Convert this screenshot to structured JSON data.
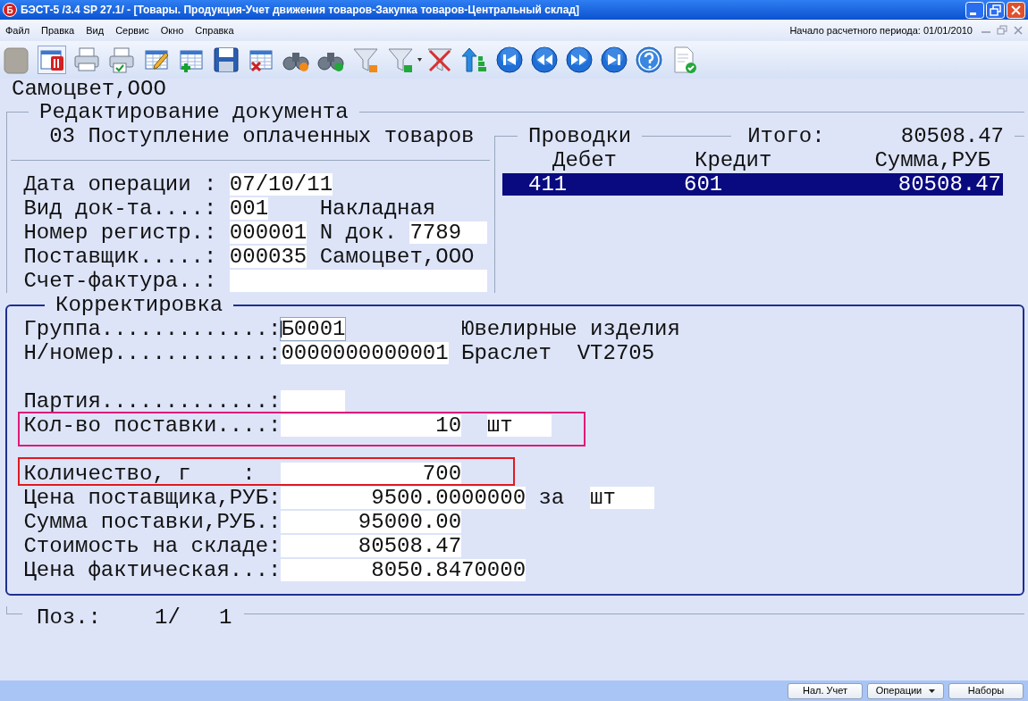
{
  "window": {
    "icon_letter": "Б",
    "title": "БЭСТ-5 /3.4 SP 27.1/ - [Товары. Продукция-Учет движения товаров-Закупка товаров-Центральный склад]"
  },
  "menu": [
    "Файл",
    "Правка",
    "Вид",
    "Сервис",
    "Окно",
    "Справка"
  ],
  "period": "Начало расчетного периода: 01/01/2010",
  "company": "Самоцвет,ООО",
  "document": {
    "title": "Редактирование документа",
    "operation": "03 Поступление оплаченных товаров",
    "rows": [
      {
        "label": "Дата операции :",
        "cells": [
          {
            "kind": "field",
            "value": "07/10/11",
            "focused": false
          }
        ]
      },
      {
        "label": "Вид док-та....:",
        "cells": [
          {
            "kind": "field",
            "value": "001",
            "focused": false
          },
          {
            "kind": "text",
            "value": "Накладная"
          }
        ]
      },
      {
        "label": "Номер регистр.:",
        "cells": [
          {
            "kind": "field",
            "value": "000001",
            "focused": false
          },
          {
            "kind": "text",
            "value": "N док."
          },
          {
            "kind": "field",
            "value": "7789",
            "focused": false
          }
        ]
      },
      {
        "label": "Поставщик.....:",
        "cells": [
          {
            "kind": "field",
            "value": "000035",
            "focused": false
          },
          {
            "kind": "text",
            "value": "Самоцвет,ООО"
          }
        ]
      },
      {
        "label": "Счет-фактура..:",
        "cells": [
          {
            "kind": "field",
            "focused": false
          }
        ]
      }
    ]
  },
  "postings": {
    "title": "Проводки",
    "total_label": "Итого:",
    "total": "80508.47",
    "columns": [
      "Дебет",
      "Кредит",
      "Сумма,РУБ"
    ],
    "rows": [
      {
        "debit": "411",
        "credit": "601",
        "amount": "80508.47",
        "selected": true
      }
    ]
  },
  "correction": {
    "title": "Корректировка",
    "blocks": [
      [
        {
          "label": "Группа.............:",
          "cells": [
            {
              "kind": "field",
              "value": "Б0001",
              "focused": true
            },
            {
              "kind": "text",
              "value": "Ювелирные изделия"
            }
          ]
        },
        {
          "label": "Н/номер............:",
          "cells": [
            {
              "kind": "field",
              "value": "0000000000001",
              "focused": false
            },
            {
              "kind": "text",
              "value": "Браслет  VT2705"
            }
          ]
        }
      ],
      [
        {
          "label": "Партия.............:",
          "cells": [
            {
              "kind": "field",
              "focused": false
            }
          ]
        },
        {
          "label": "Кол-во поставки....:",
          "color": "#e0197a",
          "cells": [
            {
              "kind": "field",
              "value": "10",
              "focused": false
            },
            {
              "kind": "field",
              "value": "шт",
              "focused": false
            }
          ]
        }
      ],
      [
        {
          "label": "Количество, г    :",
          "color": "#e01a22",
          "cells": [
            {
              "kind": "field",
              "value": "700",
              "focused": false
            }
          ]
        },
        {
          "label": "Цена поставщика,РУБ:",
          "cells": [
            {
              "kind": "field",
              "value": "9500.0000000",
              "focused": false
            },
            {
              "kind": "text",
              "value": "за"
            },
            {
              "kind": "field",
              "value": "шт",
              "focused": false
            }
          ]
        },
        {
          "label": "Сумма поставки,РУБ.:",
          "cells": [
            {
              "kind": "field",
              "value": "95000.00",
              "focused": false
            }
          ]
        },
        {
          "label": "Стоимость на складе:",
          "cells": [
            {
              "kind": "field",
              "value": "80508.47",
              "focused": false
            }
          ]
        },
        {
          "label": "Цена фактическая...:",
          "cells": [
            {
              "kind": "field",
              "value": "8050.8470000",
              "focused": false
            }
          ]
        }
      ]
    ]
  },
  "position": {
    "label": "Поз.:",
    "value": "1/   1"
  },
  "buttons": [
    {
      "kind": "button",
      "label": "Нал. Учет"
    },
    {
      "kind": "dropdown",
      "label": "Операции"
    },
    {
      "kind": "button",
      "label": "Наборы"
    }
  ]
}
